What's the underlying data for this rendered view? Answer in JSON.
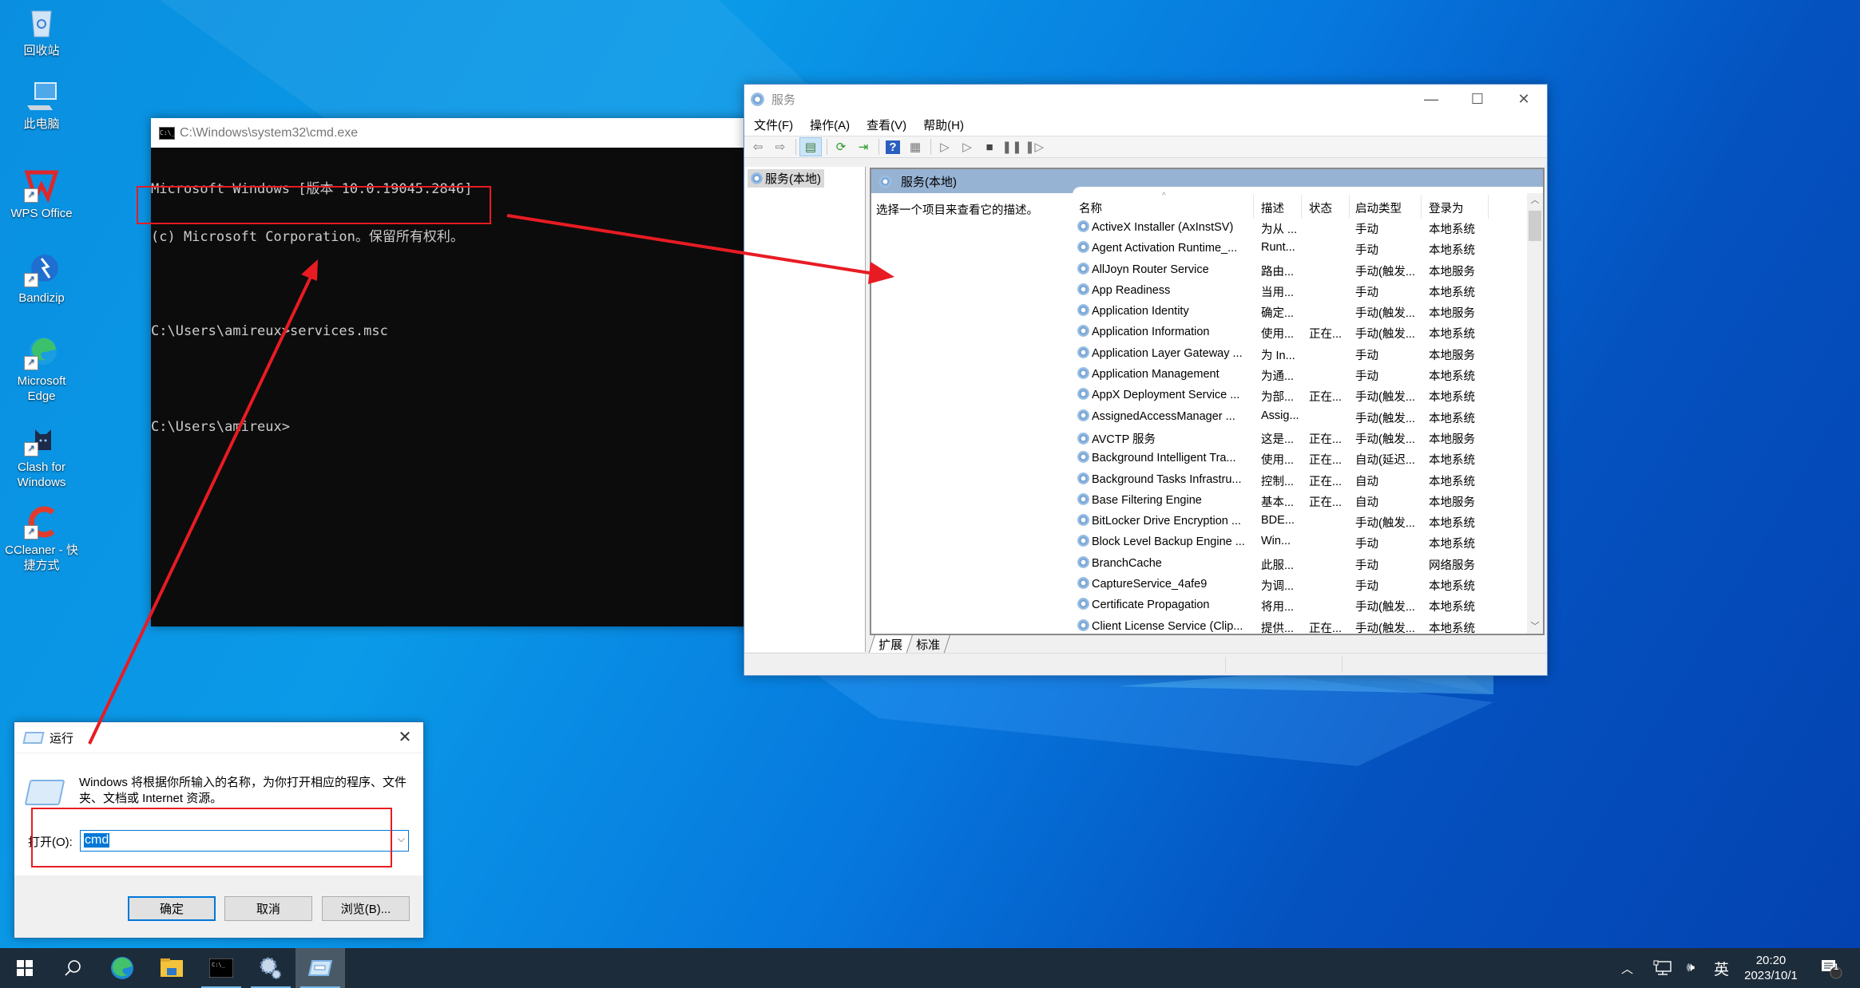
{
  "desktop": {
    "icons": [
      {
        "label": "回收站",
        "icon": "recycle-bin-icon"
      },
      {
        "label": "此电脑",
        "icon": "this-pc-icon"
      },
      {
        "label": "WPS Office",
        "icon": "wps-office-icon"
      },
      {
        "label": "Bandizip",
        "icon": "bandizip-icon"
      },
      {
        "label": "Microsoft Edge",
        "icon": "edge-icon"
      },
      {
        "label": "Clash for Windows",
        "icon": "clash-icon"
      },
      {
        "label": "CCleaner - 快捷方式",
        "icon": "ccleaner-icon"
      }
    ]
  },
  "cmd": {
    "title": "C:\\Windows\\system32\\cmd.exe",
    "lines": [
      "Microsoft Windows [版本 10.0.19045.2846]",
      "(c) Microsoft Corporation。保留所有权利。",
      "",
      "C:\\Users\\amireux>services.msc",
      "",
      "C:\\Users\\amireux>"
    ]
  },
  "services": {
    "title": "服务",
    "menu": [
      "文件(F)",
      "操作(A)",
      "查看(V)",
      "帮助(H)"
    ],
    "tree_node": "服务(本地)",
    "pane_header": "服务(本地)",
    "description_hint": "选择一个项目来查看它的描述。",
    "columns": [
      "名称",
      "描述",
      "状态",
      "启动类型",
      "登录为"
    ],
    "rows": [
      {
        "name": "ActiveX Installer (AxInstSV)",
        "desc": "为从 ...",
        "status": "",
        "startup": "手动",
        "logon": "本地系统"
      },
      {
        "name": "Agent Activation Runtime_...",
        "desc": "Runt...",
        "status": "",
        "startup": "手动",
        "logon": "本地系统"
      },
      {
        "name": "AllJoyn Router Service",
        "desc": "路由...",
        "status": "",
        "startup": "手动(触发...",
        "logon": "本地服务"
      },
      {
        "name": "App Readiness",
        "desc": "当用...",
        "status": "",
        "startup": "手动",
        "logon": "本地系统"
      },
      {
        "name": "Application Identity",
        "desc": "确定...",
        "status": "",
        "startup": "手动(触发...",
        "logon": "本地服务"
      },
      {
        "name": "Application Information",
        "desc": "使用...",
        "status": "正在...",
        "startup": "手动(触发...",
        "logon": "本地系统"
      },
      {
        "name": "Application Layer Gateway ...",
        "desc": "为 In...",
        "status": "",
        "startup": "手动",
        "logon": "本地服务"
      },
      {
        "name": "Application Management",
        "desc": "为通...",
        "status": "",
        "startup": "手动",
        "logon": "本地系统"
      },
      {
        "name": "AppX Deployment Service ...",
        "desc": "为部...",
        "status": "正在...",
        "startup": "手动(触发...",
        "logon": "本地系统"
      },
      {
        "name": "AssignedAccessManager ...",
        "desc": "Assig...",
        "status": "",
        "startup": "手动(触发...",
        "logon": "本地系统"
      },
      {
        "name": "AVCTP 服务",
        "desc": "这是...",
        "status": "正在...",
        "startup": "手动(触发...",
        "logon": "本地服务"
      },
      {
        "name": "Background Intelligent Tra...",
        "desc": "使用...",
        "status": "正在...",
        "startup": "自动(延迟...",
        "logon": "本地系统"
      },
      {
        "name": "Background Tasks Infrastru...",
        "desc": "控制...",
        "status": "正在...",
        "startup": "自动",
        "logon": "本地系统"
      },
      {
        "name": "Base Filtering Engine",
        "desc": "基本...",
        "status": "正在...",
        "startup": "自动",
        "logon": "本地服务"
      },
      {
        "name": "BitLocker Drive Encryption ...",
        "desc": "BDE...",
        "status": "",
        "startup": "手动(触发...",
        "logon": "本地系统"
      },
      {
        "name": "Block Level Backup Engine ...",
        "desc": "Win...",
        "status": "",
        "startup": "手动",
        "logon": "本地系统"
      },
      {
        "name": "BranchCache",
        "desc": "此服...",
        "status": "",
        "startup": "手动",
        "logon": "网络服务"
      },
      {
        "name": "CaptureService_4afe9",
        "desc": "为调...",
        "status": "",
        "startup": "手动",
        "logon": "本地系统"
      },
      {
        "name": "Certificate Propagation",
        "desc": "将用...",
        "status": "",
        "startup": "手动(触发...",
        "logon": "本地系统"
      },
      {
        "name": "Client License Service (Clip...",
        "desc": "提供...",
        "status": "正在...",
        "startup": "手动(触发...",
        "logon": "本地系统"
      }
    ],
    "tabs": [
      "扩展",
      "标准"
    ]
  },
  "run_dialog": {
    "title": "运行",
    "message": "Windows 将根据你所输入的名称，为你打开相应的程序、文件夹、文档或 Internet 资源。",
    "open_label": "打开(O):",
    "input_value": "cmd",
    "ok_label": "确定",
    "cancel_label": "取消",
    "browse_label": "浏览(B)..."
  },
  "taskbar": {
    "time": "20:20",
    "date": "2023/10/1",
    "ime": "英",
    "notification_count": "1"
  },
  "annotation_color": "#e81b23"
}
